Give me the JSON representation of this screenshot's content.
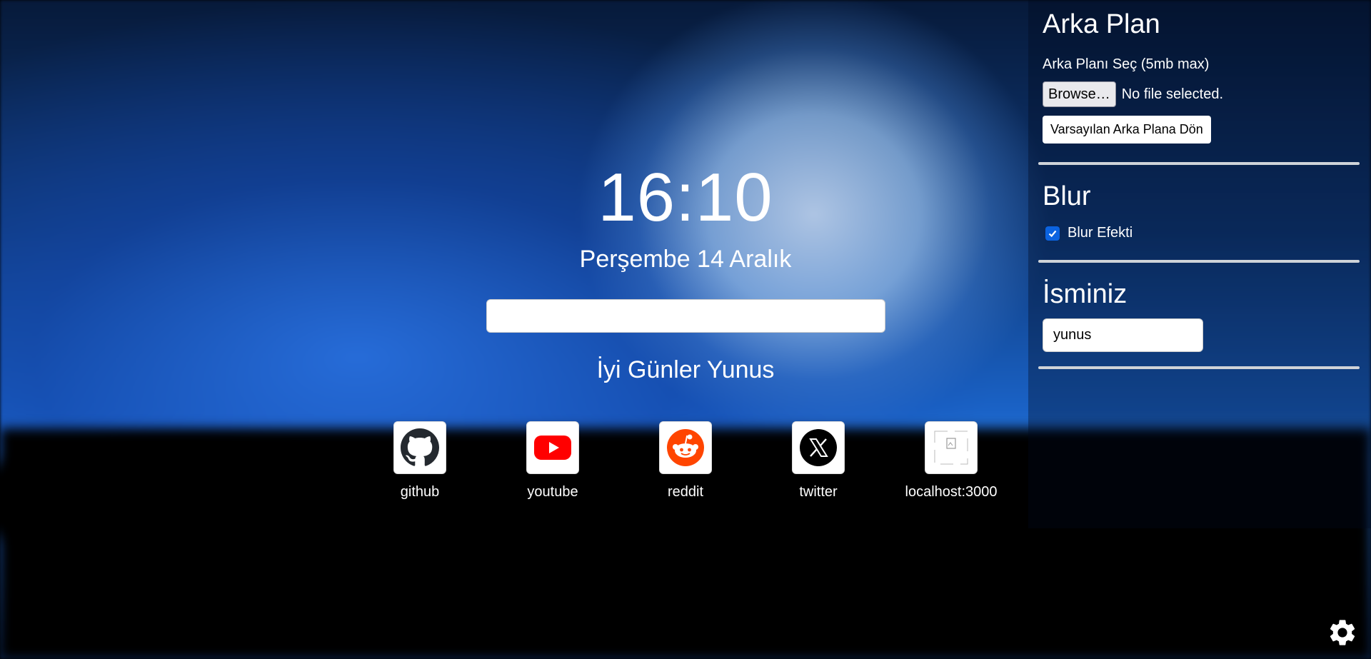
{
  "clock": {
    "time": "16:10"
  },
  "date": {
    "text": "Perşembe 14 Aralık"
  },
  "search": {
    "value": ""
  },
  "greeting": {
    "text": "İyi Günler Yunus"
  },
  "shortcuts": [
    {
      "label": "github",
      "icon": "github-icon"
    },
    {
      "label": "youtube",
      "icon": "youtube-icon"
    },
    {
      "label": "reddit",
      "icon": "reddit-icon"
    },
    {
      "label": "twitter",
      "icon": "x-icon"
    },
    {
      "label": "localhost:3000",
      "icon": "broken-image-icon"
    }
  ],
  "settings": {
    "background": {
      "title": "Arka Plan",
      "choose_label": "Arka Planı Seç (5mb max)",
      "browse_label": "Browse…",
      "file_status": "No file selected.",
      "reset_label": "Varsayılan Arka Plana Dön"
    },
    "blur": {
      "title": "Blur",
      "checkbox_label": "Blur Efekti",
      "checked": true
    },
    "name": {
      "title": "İsminiz",
      "value": "yunus"
    }
  },
  "colors": {
    "accent": "#0b63e0",
    "youtube": "#ff0000",
    "reddit": "#ff4500"
  }
}
